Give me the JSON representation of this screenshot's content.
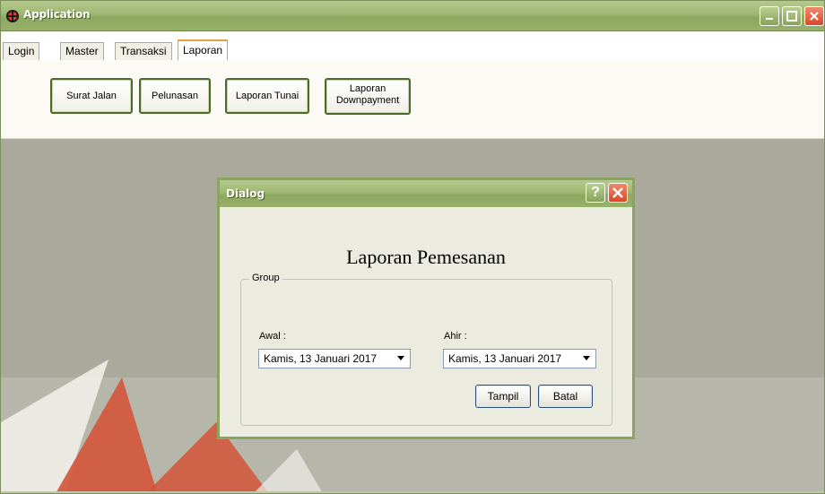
{
  "app": {
    "title": "Application"
  },
  "tabs": [
    {
      "label": "Login",
      "active": false
    },
    {
      "label": "Master",
      "active": false
    },
    {
      "label": "Transaksi",
      "active": false
    },
    {
      "label": "Laporan",
      "active": true
    }
  ],
  "laporan_buttons": {
    "surat_jalan": "Surat Jalan",
    "pelunasan": "Pelunasan",
    "laporan_tunai": "Laporan Tunai",
    "laporan_downpayment_line1": "Laporan",
    "laporan_downpayment_line2": "Downpayment"
  },
  "dialog": {
    "title": "Dialog",
    "help_glyph": "?",
    "heading": "Laporan Pemesanan",
    "group_label": "Group",
    "awal_label": "Awal :",
    "awal_value": "Kamis, 13 Januari 2017",
    "ahir_label": "Ahir :",
    "ahir_value": "Kamis, 13 Januari 2017",
    "tampil_button": "Tampil",
    "batal_button": "Batal"
  },
  "colors": {
    "titlebar": "#9fb774",
    "close_button": "#d9482a",
    "workspace": "#a9a99c",
    "active_tab_accent": "#e8a33c"
  },
  "icons": {
    "app_icon": "app-icon",
    "minimize": "minimize-icon",
    "maximize": "maximize-icon",
    "close": "close-icon",
    "help": "help-icon",
    "dropdown": "chevron-down-icon"
  }
}
